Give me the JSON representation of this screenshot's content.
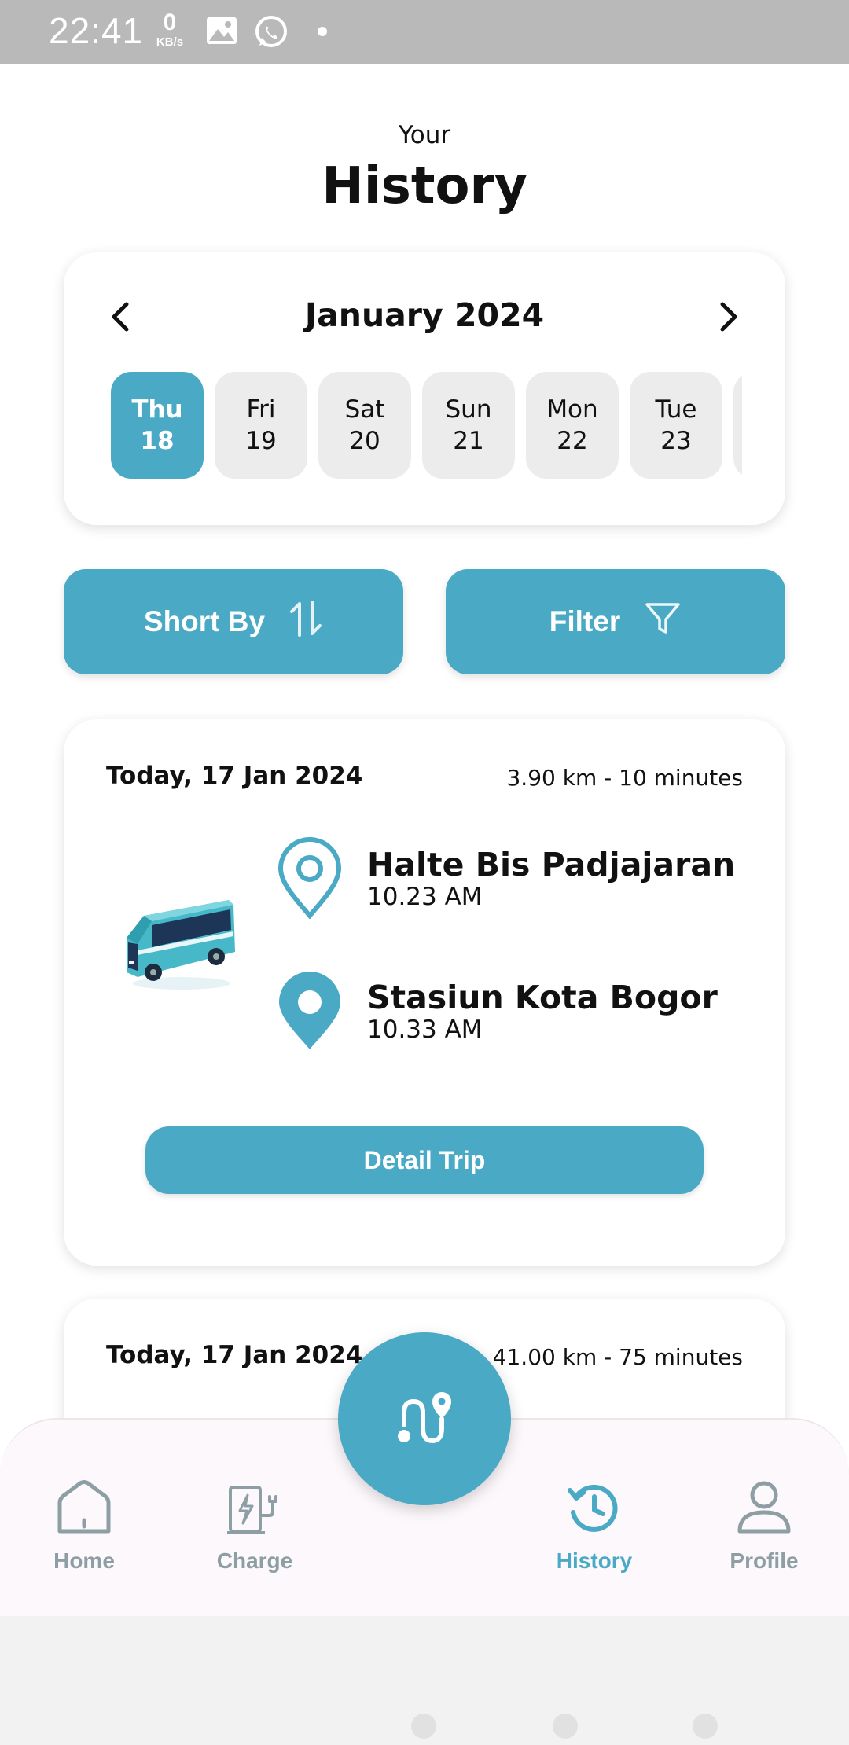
{
  "status_bar": {
    "time": "22:41",
    "net_speed": "0",
    "net_unit": "KB/s",
    "icons": [
      "gallery-icon",
      "whatsapp-icon",
      "dot-icon"
    ]
  },
  "header": {
    "subtitle": "Your",
    "title": "History"
  },
  "calendar": {
    "month_label": "January 2024",
    "prev_icon": "chevron-left-icon",
    "next_icon": "chevron-right-icon",
    "days": [
      {
        "name": "Thu",
        "num": "18",
        "active": true
      },
      {
        "name": "Fri",
        "num": "19",
        "active": false
      },
      {
        "name": "Sat",
        "num": "20",
        "active": false
      },
      {
        "name": "Sun",
        "num": "21",
        "active": false
      },
      {
        "name": "Mon",
        "num": "22",
        "active": false
      },
      {
        "name": "Tue",
        "num": "23",
        "active": false
      },
      {
        "name": "",
        "num": "",
        "active": false
      }
    ]
  },
  "actions": {
    "sort_label": "Short By",
    "sort_icon": "sort-arrows-icon",
    "filter_label": "Filter",
    "filter_icon": "funnel-icon"
  },
  "trips": [
    {
      "date": "Today, 17 Jan 2024",
      "meta": "3.90 km - 10 minutes",
      "origin": {
        "name": "Halte Bis Padjajaran",
        "time": "10.23 AM"
      },
      "destination": {
        "name": "Stasiun Kota Bogor",
        "time": "10.33 AM"
      },
      "button_label": "Detail Trip"
    },
    {
      "date": "Today, 17 Jan 2024",
      "meta": "41.00 km - 75 minutes"
    }
  ],
  "bottom_nav": {
    "items": [
      {
        "label": "Home",
        "icon": "home-icon",
        "active": false
      },
      {
        "label": "Charge",
        "icon": "charging-station-icon",
        "active": false
      },
      {
        "label": "History",
        "icon": "history-clock-icon",
        "active": true
      },
      {
        "label": "Profile",
        "icon": "profile-icon",
        "active": false
      }
    ],
    "fab_icon": "route-icon"
  },
  "colors": {
    "accent": "#4aa9c5",
    "nav_inactive": "#8d9fa4",
    "day_inactive_bg": "#ececec",
    "status_bar": "#b9b9b9"
  }
}
